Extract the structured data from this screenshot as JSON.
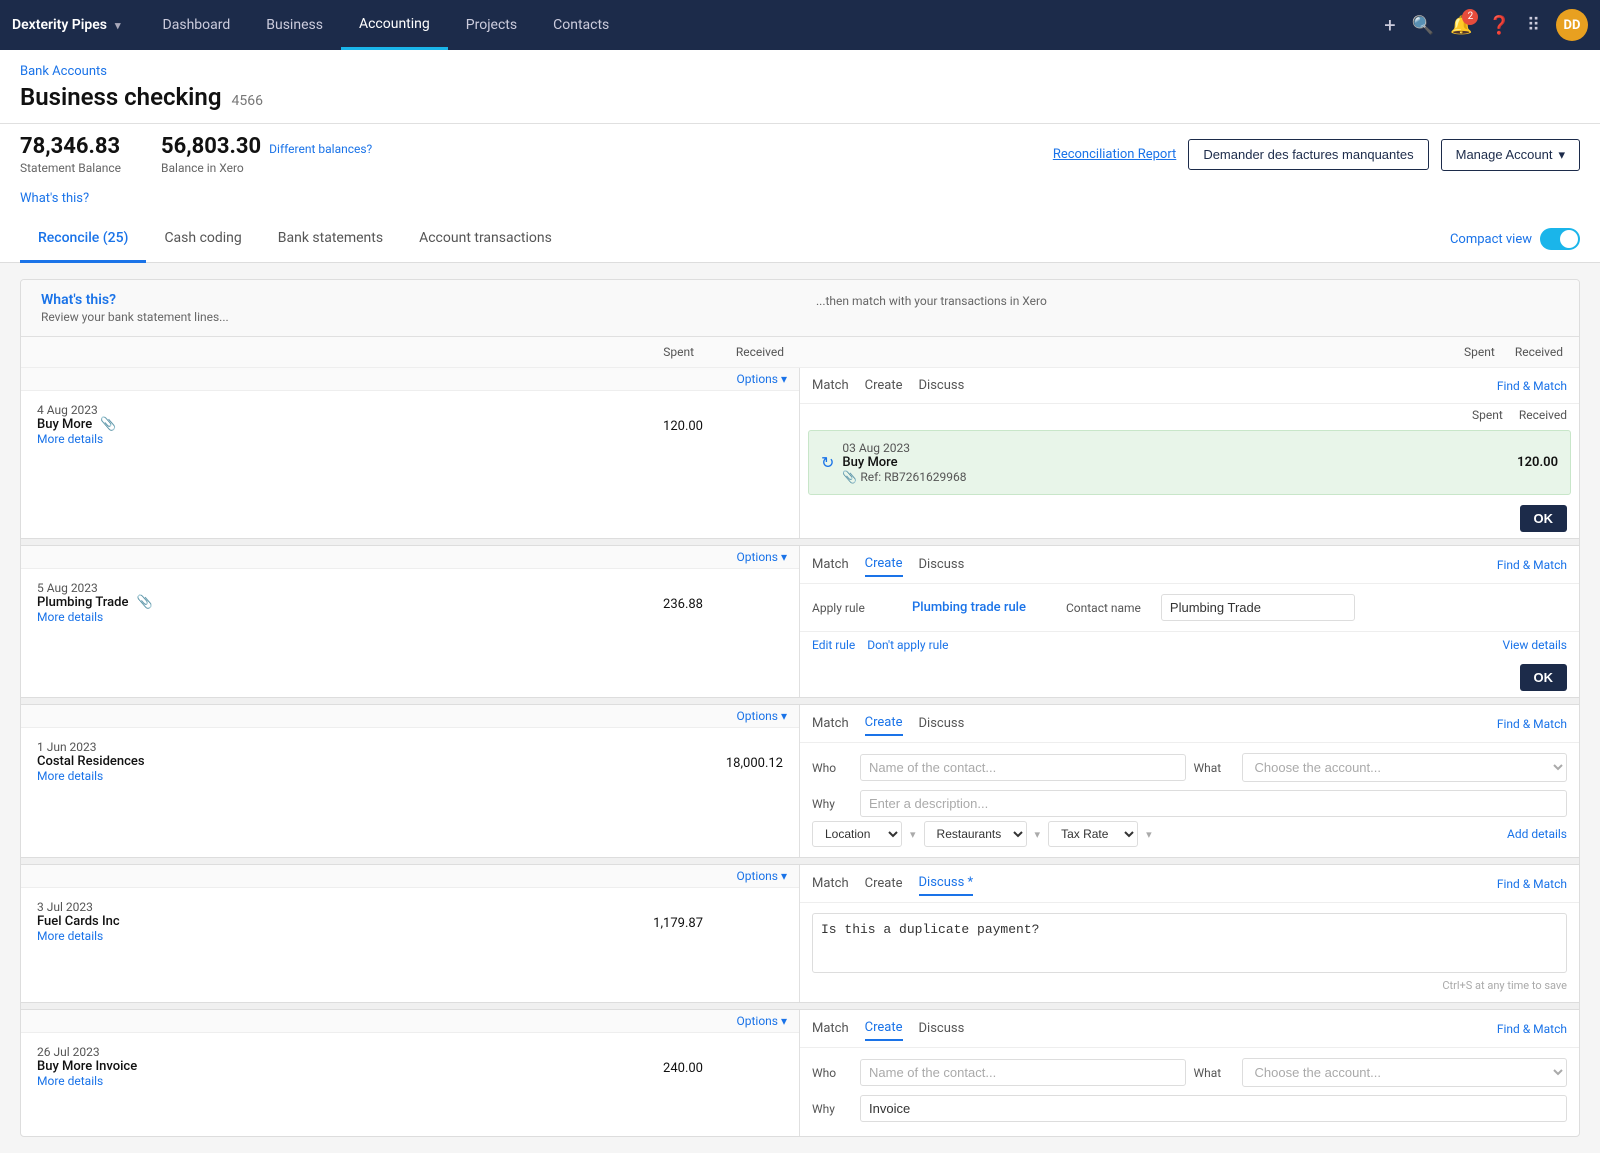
{
  "nav": {
    "brand": "Dexterity Pipes",
    "dropdown_arrow": "▾",
    "items": [
      {
        "label": "Dashboard",
        "active": false
      },
      {
        "label": "Business",
        "active": false
      },
      {
        "label": "Accounting",
        "active": true
      },
      {
        "label": "Projects",
        "active": false
      },
      {
        "label": "Contacts",
        "active": false
      }
    ],
    "notification_count": "2",
    "avatar_initials": "DD"
  },
  "breadcrumb": "Bank Accounts",
  "page_title": "Business checking",
  "account_number": "4566",
  "balance": {
    "statement": "78,346.83",
    "statement_label": "Statement Balance",
    "xero": "56,803.30",
    "xero_label": "Balance in Xero",
    "diff_link": "Different balances?"
  },
  "actions": {
    "recon_report": "Reconciliation Report",
    "factures_btn": "Demander des factures manquantes",
    "manage_account": "Manage Account"
  },
  "whats_this": "What's this?",
  "tabs": [
    {
      "label": "Reconcile (25)",
      "active": true
    },
    {
      "label": "Cash coding",
      "active": false
    },
    {
      "label": "Bank statements",
      "active": false
    },
    {
      "label": "Account transactions",
      "active": false
    }
  ],
  "compact_view_label": "Compact view",
  "section_header": {
    "title": "What's this?",
    "subtitle": "Review your bank statement lines...",
    "right_subtitle": "...then match with your transactions in Xero"
  },
  "col_headers": {
    "spent": "Spent",
    "received": "Received"
  },
  "transactions": [
    {
      "date": "4 Aug 2023",
      "name": "Buy More",
      "more": "More details",
      "spent": "120.00",
      "received": "",
      "has_attach": true
    },
    {
      "date": "5 Aug 2023",
      "name": "Plumbing Trade",
      "more": "More details",
      "spent": "236.88",
      "received": "",
      "has_attach": true
    },
    {
      "date": "1 Jun 2023",
      "name": "Costal Residences",
      "more": "More details",
      "spent": "",
      "received": "18,000.12",
      "has_attach": false
    },
    {
      "date": "3 Jul 2023",
      "name": "Fuel Cards Inc",
      "more": "More details",
      "spent": "1,179.87",
      "received": "",
      "has_attach": false
    },
    {
      "date": "26 Jul 2023",
      "name": "Buy More Invoice",
      "more": "More details",
      "spent": "240.00",
      "received": "",
      "has_attach": false
    }
  ],
  "match_sections": [
    {
      "type": "match",
      "tabs": [
        "Match",
        "Create",
        "Discuss"
      ],
      "active_tab": "Match",
      "find_match": "Find & Match",
      "matched_date": "03 Aug 2023",
      "matched_name": "Buy More",
      "matched_ref": "Ref: RB7261629968",
      "matched_amount": "120.00"
    },
    {
      "type": "apply_rule",
      "tabs": [
        "Match",
        "Create",
        "Discuss"
      ],
      "active_tab": "Create",
      "find_match": "Find & Match",
      "apply_rule_label": "Apply rule",
      "rule_name": "Plumbing trade rule",
      "contact_name_label": "Contact name",
      "contact_name_value": "Plumbing Trade",
      "edit_rule": "Edit rule",
      "dont_apply": "Don't apply rule",
      "view_details": "View details"
    },
    {
      "type": "create_form",
      "tabs": [
        "Match",
        "Create",
        "Discuss"
      ],
      "active_tab": "Create",
      "find_match": "Find & Match",
      "who_placeholder": "Name of the contact...",
      "what_placeholder": "Choose the account...",
      "why_placeholder": "Enter a description...",
      "location_value": "Location",
      "restaurant_value": "Restaurants",
      "tax_rate_value": "Tax Rate",
      "add_details": "Add details"
    },
    {
      "type": "discuss",
      "tabs": [
        "Match",
        "Create",
        "Discuss *"
      ],
      "active_tab": "Discuss *",
      "find_match": "Find & Match",
      "discuss_text": "Is this a duplicate payment?",
      "discuss_hint": "Ctrl+S at any time to save"
    },
    {
      "type": "create_form2",
      "tabs": [
        "Match",
        "Create",
        "Discuss"
      ],
      "active_tab": "Create",
      "find_match": "Find & Match",
      "who_placeholder": "Name of the contact...",
      "what_placeholder": "Choose the account...",
      "why_value": "Invoice"
    }
  ],
  "options_label": "Options"
}
